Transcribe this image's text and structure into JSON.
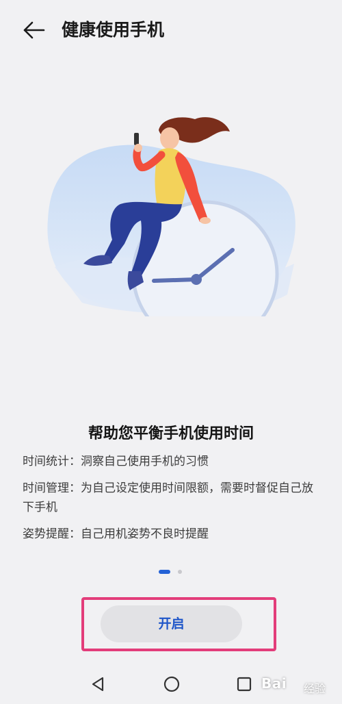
{
  "header": {
    "back_icon": "arrow-left-icon",
    "title": "健康使用手机"
  },
  "illustration": {
    "subject": "woman-sitting-on-clock",
    "colors": {
      "blob": "#cfe0f6",
      "clock": "#e9eef7",
      "hands": "#5b6fb2",
      "shirt": "#f3d25a",
      "sleeve": "#f24f3c",
      "pants": "#2a3e98",
      "hair": "#7a2e1b"
    }
  },
  "intro": {
    "headline": "帮助您平衡手机使用时间",
    "features": [
      "时间统计：洞察自己使用手机的习惯",
      "时间管理：为自己设定使用时间限额，需要时督促自己放下手机",
      "姿势提醒：自己用机姿势不良时提醒"
    ]
  },
  "pager": {
    "active_index": 0,
    "count": 2,
    "active_color": "#2462d6"
  },
  "actions": {
    "start_label": "开启",
    "highlight_color": "#e33d7a",
    "label_color": "#1f56c9"
  },
  "navbar": {
    "icons": [
      "back-triangle-icon",
      "home-circle-icon",
      "recents-square-icon"
    ]
  },
  "watermark": {
    "text": "Bai",
    "suffix": "经验"
  }
}
